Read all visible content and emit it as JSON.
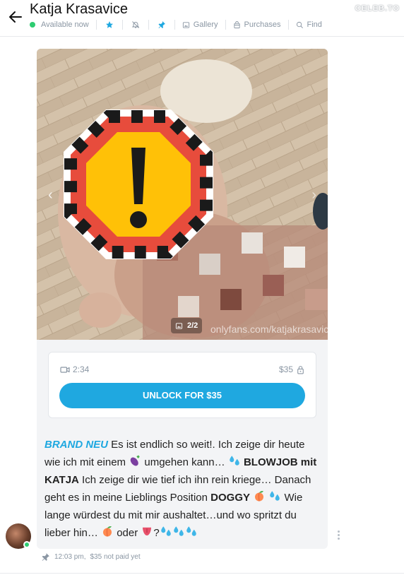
{
  "header": {
    "title": "Katja Krasavice",
    "status": "Available now",
    "watermark": "CELEB.TO",
    "tabs": [
      {
        "label": "Gallery",
        "icon": "image-icon"
      },
      {
        "label": "Purchases",
        "icon": "bag-icon"
      },
      {
        "label": "Find",
        "icon": "search-icon"
      }
    ]
  },
  "media": {
    "counter": "2/2",
    "watermark_text": "onlyfans.com/katjakrasavice"
  },
  "lock": {
    "duration": "2:34",
    "price": "$35",
    "unlock_label": "UNLOCK FOR $35"
  },
  "message": {
    "brand": "BRAND NEU",
    "p1": " Es ist endlich so weit!. Ich zeige dir heute wie ich mit einem ",
    "p2": " umgehen kann… ",
    "bold1": "BLOWJOB mit KATJA",
    "p3": " Ich zeige dir wie tief ich ihn rein kriege… Danach geht es in meine Lieblings Position ",
    "bold2": "DOGGY",
    "p4": " Wie lange würdest du mit mir aushaltet…und wo spritzt du lieber hin… ",
    "p5": " oder ",
    "p6": "?"
  },
  "footer": {
    "time": "12:03 pm,",
    "paid_status": "$35 not paid yet"
  },
  "colors": {
    "accent": "#1fa8e0",
    "online": "#2ecc71",
    "muted": "#8a96a3"
  }
}
